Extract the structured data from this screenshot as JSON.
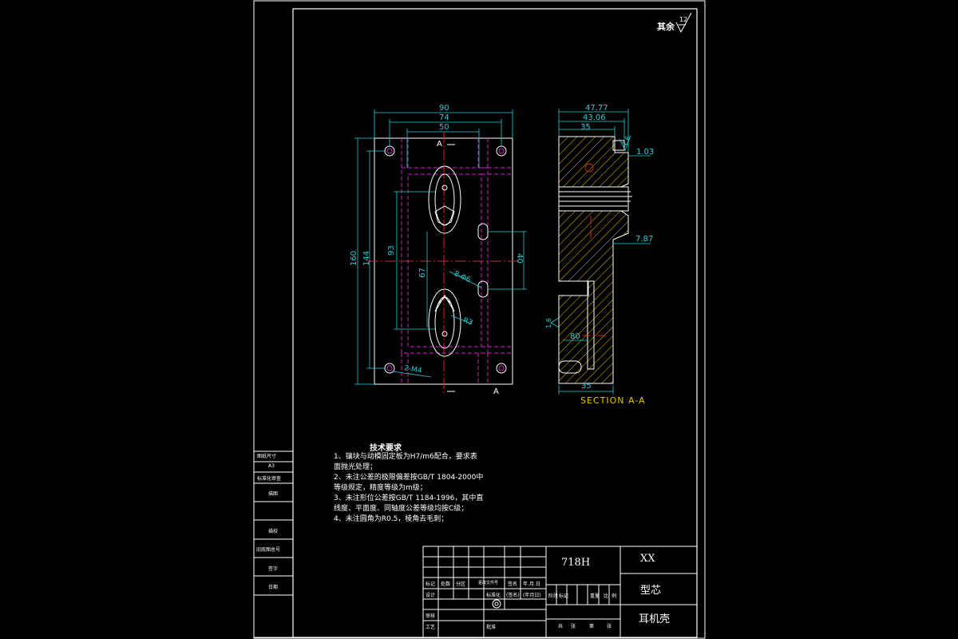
{
  "roughness": {
    "label": "其余",
    "value": "12"
  },
  "front_view": {
    "dims": {
      "w90": "90",
      "w74": "74",
      "w50": "50",
      "h160": "160",
      "h144": "144",
      "h93": "93",
      "h67": "67",
      "h40": "40",
      "holes8": "8-Φ6",
      "holes2": "2-M4",
      "r3": "R3"
    },
    "section_marks": [
      "A",
      "A"
    ]
  },
  "section_view": {
    "dims": {
      "d4777": "47.77",
      "d4306": "43.06",
      "d35_top": "35",
      "d103": "1.03",
      "d787": "7.87",
      "d80": "80",
      "d35_bot": "35",
      "rough_top": "1.6",
      "rough_side": "1.6"
    },
    "title": "SECTION A-A"
  },
  "tech_requirements": {
    "heading": "技术要求",
    "items": [
      "1、镶块与动模固定板为H7/m6配合，要求表",
      "   面抛光处理；",
      "2、未注公差的极限偏差按GB/T 1804-2000中",
      "   等级规定，精度等级为m级；",
      "3、未注形位公差按GB/T 1184-1996，其中直",
      "   线度、平面度、同轴度公差等级均按C级；",
      "4、未注圆角为R0.5，棱角去毛刺；"
    ]
  },
  "left_strip": {
    "cells": [
      "图纸尺寸",
      "A3",
      "标准化审查",
      "描图",
      "",
      "描校",
      "旧底图总号",
      "签字",
      "日期"
    ]
  },
  "title_block": {
    "material": "718H",
    "company": "XX",
    "part_name": "型芯",
    "product": "耳机壳",
    "header_row": [
      "标记",
      "处数",
      "分区",
      "更改文件号",
      "签名",
      "年.月.日"
    ],
    "row_design": [
      "设计",
      "",
      "",
      "标准化",
      "(签名)",
      "(年月日)"
    ],
    "row_check": [
      "审核",
      ""
    ],
    "row_process": [
      "工艺",
      "",
      "",
      "批准"
    ],
    "stage_labels": [
      "阶",
      "段",
      "标",
      "记",
      "重",
      "量",
      "比",
      "例"
    ],
    "sheet_labels": [
      "共",
      "张",
      "第",
      "张"
    ]
  },
  "colors": {
    "bg": "#000000",
    "line": "#ffffff",
    "dim": "#25d0d6",
    "hidden": "#d21cc8",
    "center": "#e02020",
    "hatch": "#e8c400"
  }
}
